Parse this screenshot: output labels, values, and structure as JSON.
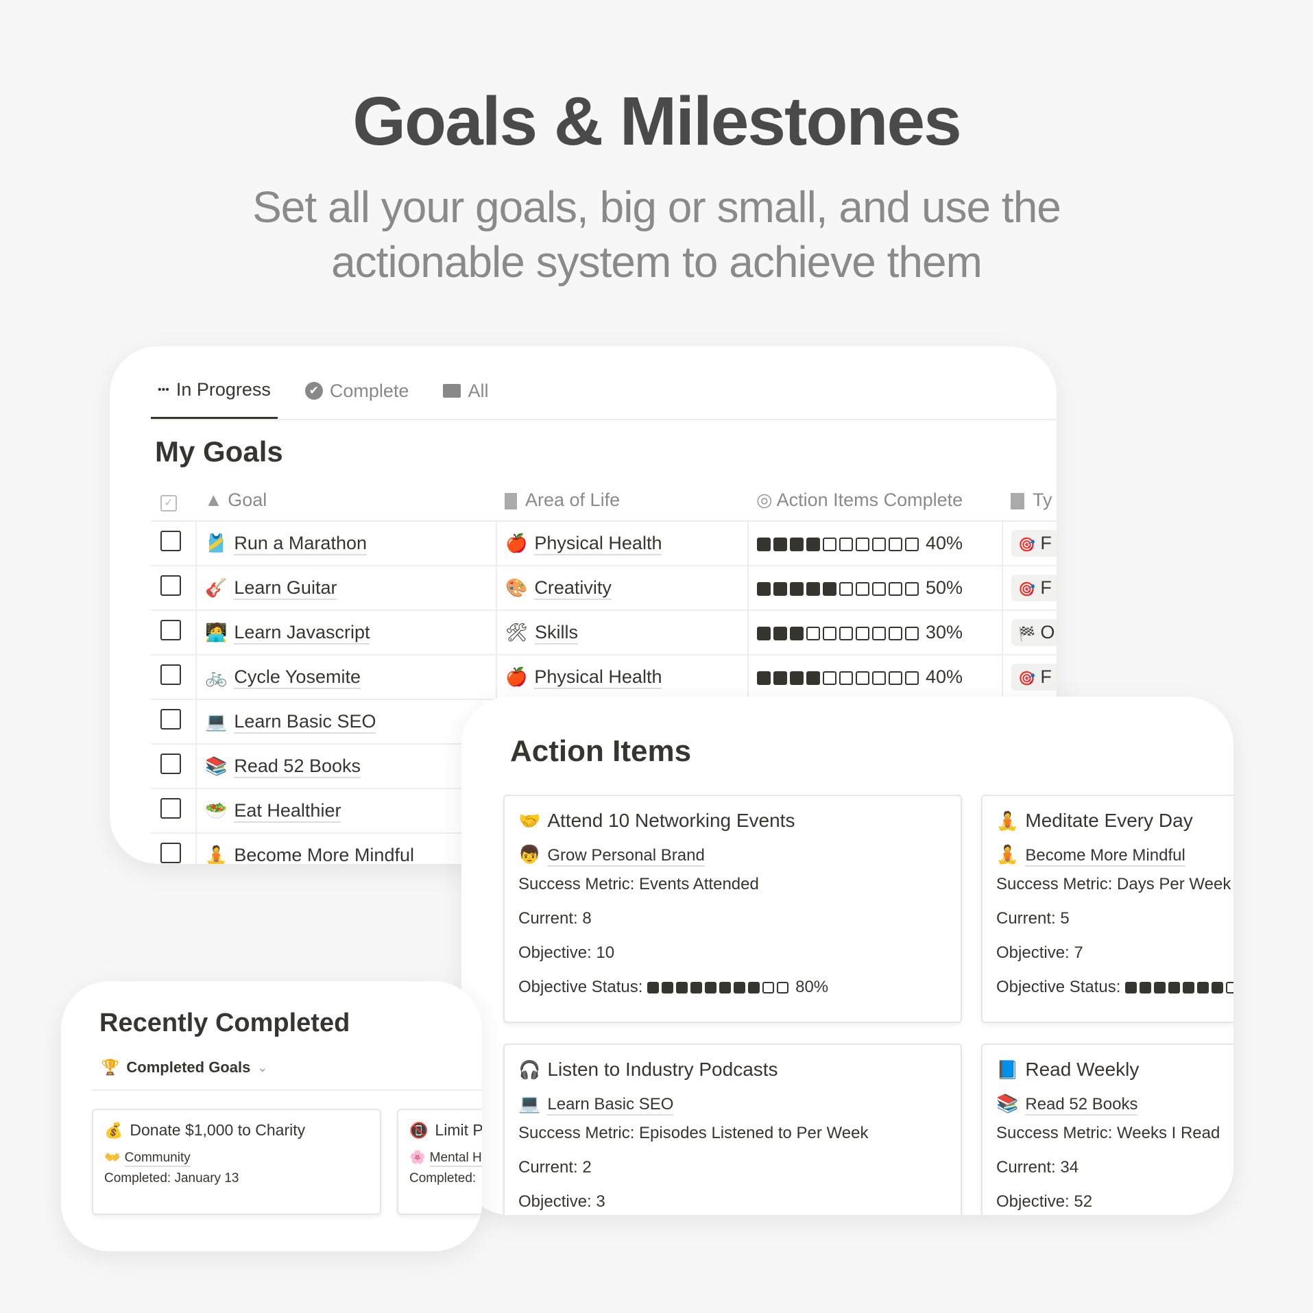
{
  "hero": {
    "title": "Goals & Milestones",
    "subtitle_line1": "Set all your goals, big or small, and use the",
    "subtitle_line2": "actionable system to achieve them"
  },
  "goals": {
    "tabs": [
      {
        "icon": "•••",
        "label": "In Progress"
      },
      {
        "icon": "✔",
        "label": "Complete"
      },
      {
        "icon": "📁",
        "label": "All"
      }
    ],
    "title": "My Goals",
    "columns": {
      "goal": "Goal",
      "area": "Area of Life",
      "progress": "Action Items Complete",
      "type": "Ty"
    },
    "rows": [
      {
        "emoji": "🎽",
        "goal": "Run a Marathon",
        "area_emoji": "🍎",
        "area": "Physical Health",
        "progress": 40,
        "progress_label": "40%",
        "type_emoji": "🎯",
        "type": "F"
      },
      {
        "emoji": "🎸",
        "goal": "Learn Guitar",
        "area_emoji": "🎨",
        "area": "Creativity",
        "progress": 50,
        "progress_label": "50%",
        "type_emoji": "🎯",
        "type": "F"
      },
      {
        "emoji": "🧑‍💻",
        "goal": "Learn Javascript",
        "area_emoji": "🛠",
        "area": "Skills",
        "progress": 30,
        "progress_label": "30%",
        "type_emoji": "🏁",
        "type": "O"
      },
      {
        "emoji": "🚲",
        "goal": "Cycle Yosemite",
        "area_emoji": "🍎",
        "area": "Physical Health",
        "progress": 40,
        "progress_label": "40%",
        "type_emoji": "🎯",
        "type": "F"
      },
      {
        "emoji": "💻",
        "goal": "Learn Basic SEO"
      },
      {
        "emoji": "📚",
        "goal": "Read 52 Books"
      },
      {
        "emoji": "🥗",
        "goal": "Eat Healthier"
      },
      {
        "emoji": "🧘",
        "goal": "Become More Mindful"
      }
    ]
  },
  "actions": {
    "title": "Action Items",
    "cards": [
      {
        "emoji": "🤝",
        "title": "Attend 10 Networking Events",
        "rel_emoji": "👦",
        "rel": "Grow Personal Brand",
        "metric": "Success Metric: Events Attended",
        "current": "Current: 8",
        "objective": "Objective: 10",
        "status_label": "Objective Status:",
        "progress": 80,
        "progress_label": "80%"
      },
      {
        "emoji": "🧘",
        "title": "Meditate Every Day",
        "rel_emoji": "🧘",
        "rel": "Become More Mindful",
        "metric": "Success Metric: Days Per Week",
        "current": "Current: 5",
        "objective": "Objective: 7",
        "status_label": "Objective Status:",
        "progress": 70
      },
      {
        "emoji": "🎧",
        "title": "Listen to Industry Podcasts",
        "rel_emoji": "💻",
        "rel": "Learn Basic SEO",
        "metric": "Success Metric: Episodes Listened to Per Week",
        "current": "Current: 2",
        "objective": "Objective: 3"
      },
      {
        "emoji": "📘",
        "title": "Read Weekly",
        "rel_emoji": "📚",
        "rel": "Read 52 Books",
        "metric": "Success Metric: Weeks I Read",
        "current": "Current: 34",
        "objective": "Objective: 52"
      }
    ]
  },
  "recent": {
    "title": "Recently Completed",
    "view_icon": "🏆",
    "view": "Completed Goals",
    "cards": [
      {
        "emoji": "💰",
        "title": "Donate $1,000 to Charity",
        "area_emoji": "👐",
        "area": "Community",
        "completed": "Completed: January 13"
      },
      {
        "emoji": "📵",
        "title": "Limit Phone Use",
        "area_emoji": "🌸",
        "area": "Mental Health",
        "completed": "Completed:"
      }
    ]
  }
}
